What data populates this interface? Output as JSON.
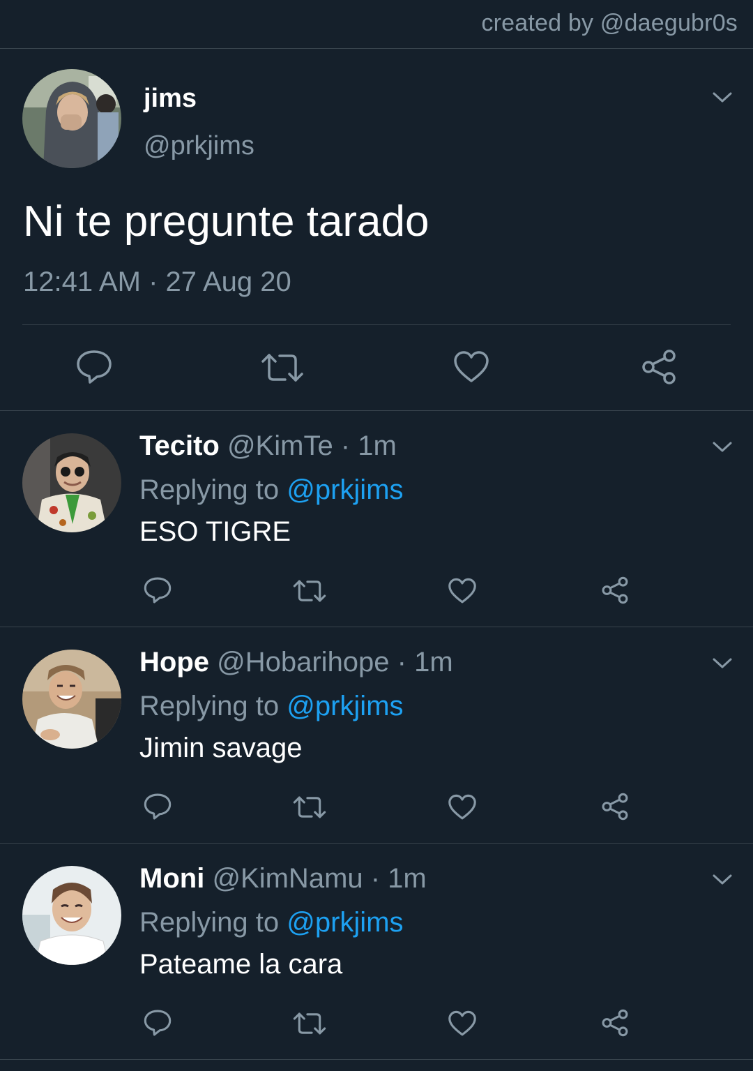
{
  "credit": "created by @daegubr0s",
  "main_tweet": {
    "name": "jims",
    "handle": "@prkjims",
    "text": "Ni te pregunte tarado",
    "timestamp": "12:41 AM · 27 Aug 20",
    "actions": [
      "reply-icon",
      "retweet-icon",
      "like-icon",
      "share-icon"
    ]
  },
  "replies": [
    {
      "name": "Tecito",
      "meta": "@KimTe · 1m",
      "replying_label": "Replying to",
      "replying_to": "@prkjims",
      "text": "ESO TIGRE"
    },
    {
      "name": "Hope",
      "meta": "@Hobarihope · 1m",
      "replying_label": "Replying to",
      "replying_to": "@prkjims",
      "text": "Jimin savage"
    },
    {
      "name": "Moni",
      "meta": "@KimNamu · 1m",
      "replying_label": "Replying to",
      "replying_to": "@prkjims",
      "text": "Pateame la cara"
    }
  ],
  "colors": {
    "background": "#15202b",
    "secondary_text": "#8899a6",
    "accent": "#1da1f2",
    "divider": "#38444d"
  }
}
